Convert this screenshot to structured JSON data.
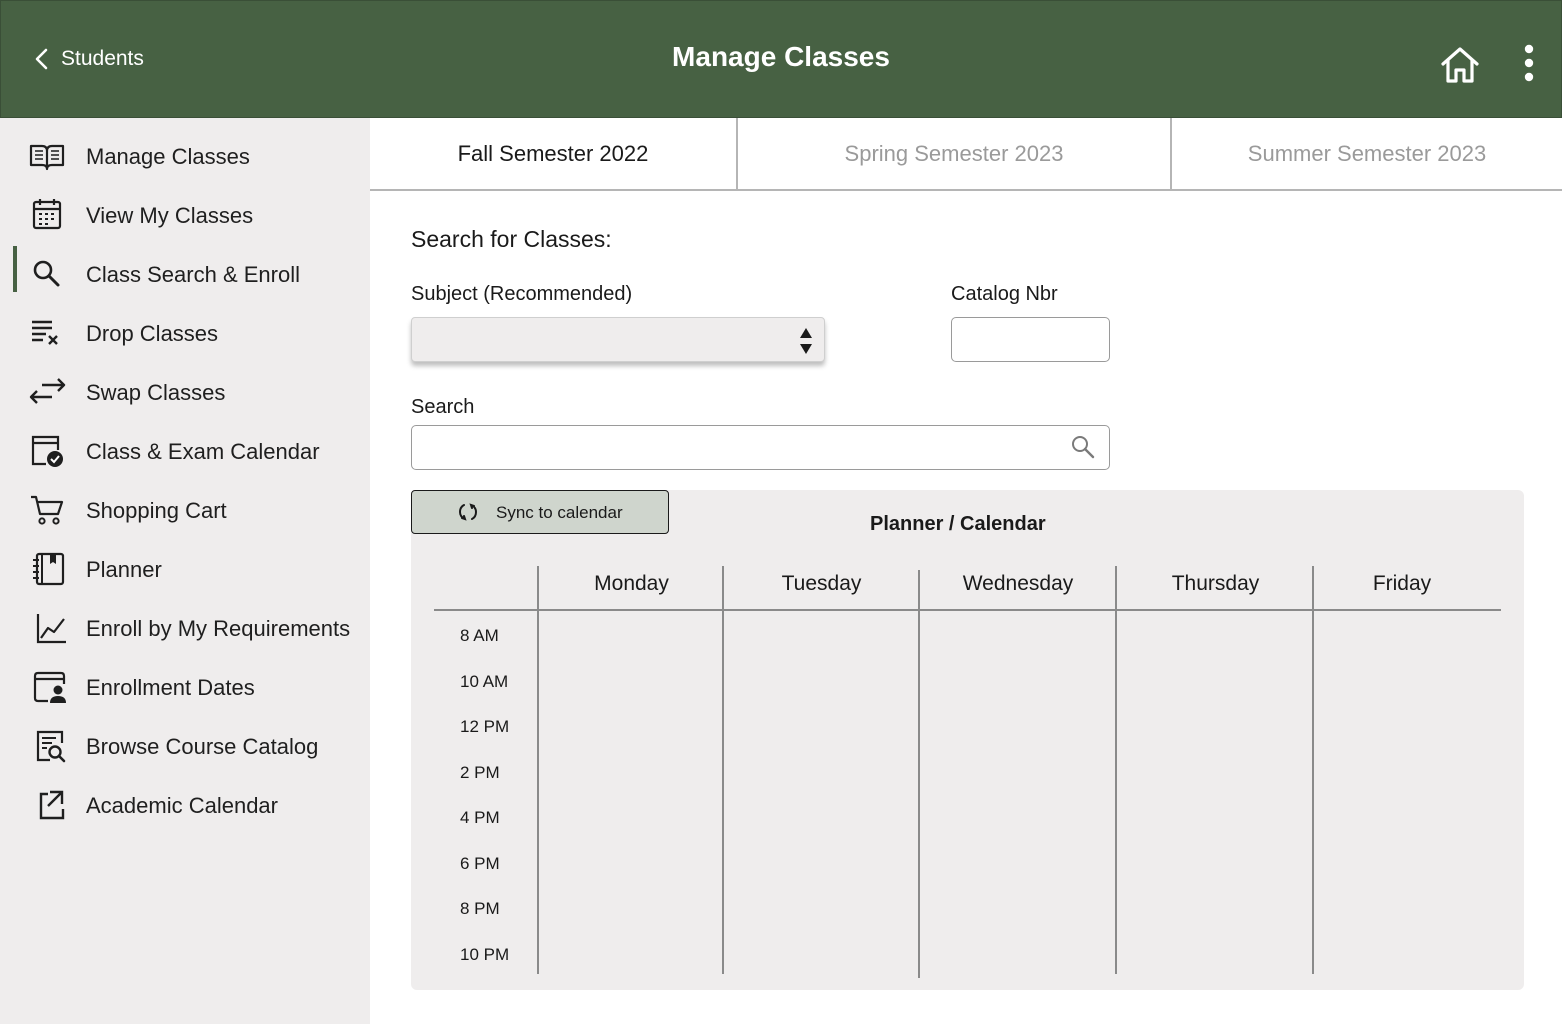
{
  "header": {
    "back_label": "Students",
    "title": "Manage Classes",
    "home_icon": "home-icon",
    "more_icon": "more-vertical-icon",
    "background": "#476143"
  },
  "sidebar": {
    "active_index": 2,
    "items": [
      {
        "label": "Manage Classes",
        "icon": "book-open-icon"
      },
      {
        "label": "View My Classes",
        "icon": "calendar-icon"
      },
      {
        "label": "Class Search & Enroll",
        "icon": "search-icon"
      },
      {
        "label": "Drop Classes",
        "icon": "list-remove-icon"
      },
      {
        "label": "Swap Classes",
        "icon": "swap-arrows-icon"
      },
      {
        "label": "Class & Exam Calendar",
        "icon": "calendar-check-icon"
      },
      {
        "label": "Shopping Cart",
        "icon": "cart-icon"
      },
      {
        "label": "Planner",
        "icon": "notebook-icon"
      },
      {
        "label": "Enroll by My Requirements",
        "icon": "line-chart-icon"
      },
      {
        "label": "Enrollment Dates",
        "icon": "calendar-user-icon"
      },
      {
        "label": "Browse Course Catalog",
        "icon": "catalog-search-icon"
      },
      {
        "label": "Academic Calendar",
        "icon": "external-link-icon"
      }
    ]
  },
  "tabs": [
    {
      "label": "Fall Semester 2022",
      "active": true
    },
    {
      "label": "Spring Semester 2023",
      "active": false
    },
    {
      "label": "Summer Semester 2023",
      "active": false
    }
  ],
  "form": {
    "section_title": "Search for Classes:",
    "subject_label": "Subject (Recommended)",
    "subject_value": "",
    "catalog_label": "Catalog Nbr",
    "catalog_value": "",
    "search_label": "Search",
    "search_value": ""
  },
  "planner": {
    "sync_label": "Sync to calendar",
    "title": "Planner / Calendar",
    "days": [
      "Monday",
      "Tuesday",
      "Wednesday",
      "Thursday",
      "Friday"
    ],
    "times": [
      "8 AM",
      "10 AM",
      "12 PM",
      "2 PM",
      "4 PM",
      "6 PM",
      "8 PM",
      "10 PM"
    ]
  }
}
